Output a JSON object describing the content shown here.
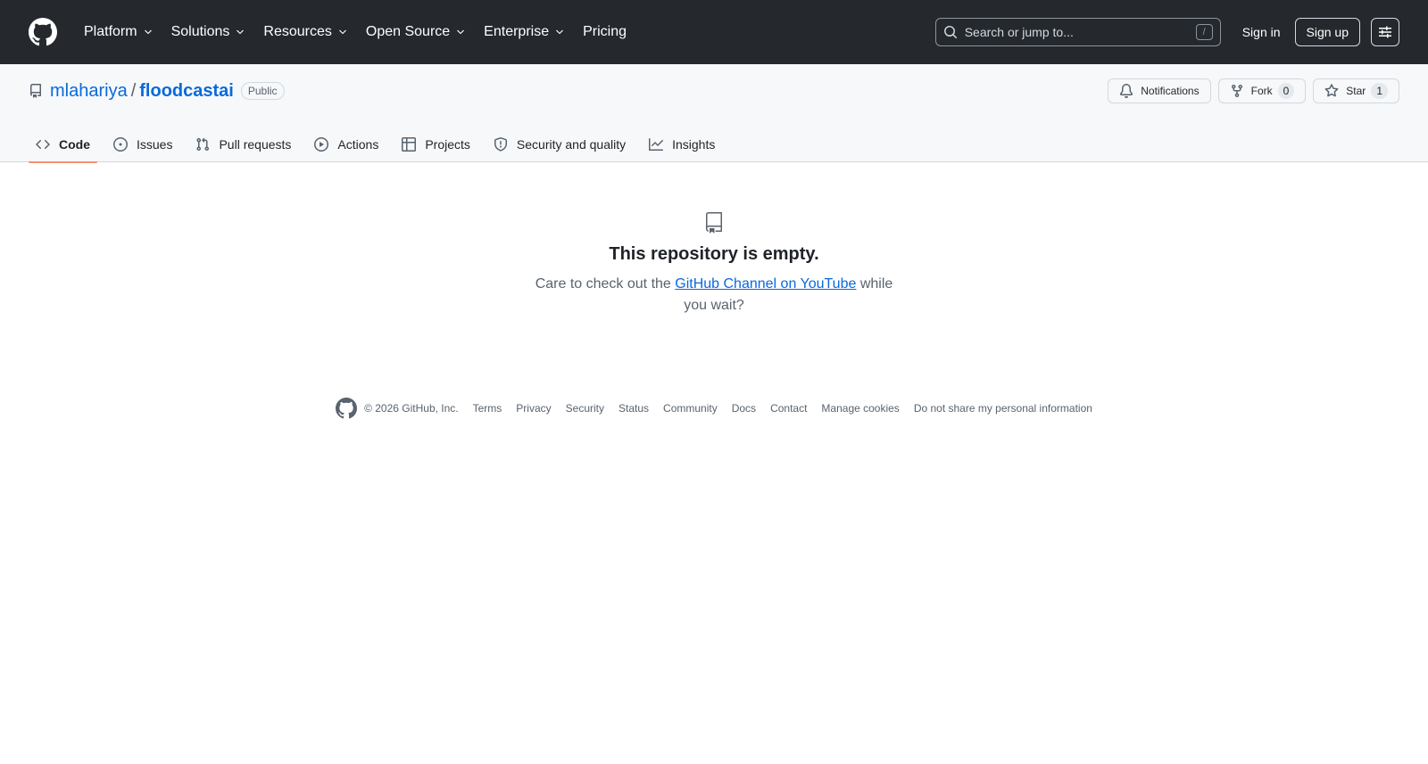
{
  "header": {
    "nav": [
      {
        "label": "Platform",
        "has_menu": true
      },
      {
        "label": "Solutions",
        "has_menu": true
      },
      {
        "label": "Resources",
        "has_menu": true
      },
      {
        "label": "Open Source",
        "has_menu": true
      },
      {
        "label": "Enterprise",
        "has_menu": true
      },
      {
        "label": "Pricing",
        "has_menu": false
      }
    ],
    "search_placeholder": "Search or jump to...",
    "search_shortcut": "/",
    "sign_in": "Sign in",
    "sign_up": "Sign up"
  },
  "repo": {
    "owner": "mlahariya",
    "separator": "/",
    "name": "floodcastai",
    "visibility": "Public",
    "notifications_label": "Notifications",
    "fork_label": "Fork",
    "fork_count": "0",
    "star_label": "Star",
    "star_count": "1"
  },
  "tabs": [
    {
      "label": "Code",
      "icon": "code-icon",
      "active": true
    },
    {
      "label": "Issues",
      "icon": "issue-opened-icon",
      "active": false
    },
    {
      "label": "Pull requests",
      "icon": "git-pull-request-icon",
      "active": false
    },
    {
      "label": "Actions",
      "icon": "play-icon",
      "active": false
    },
    {
      "label": "Projects",
      "icon": "table-icon",
      "active": false
    },
    {
      "label": "Security and quality",
      "icon": "shield-icon",
      "active": false
    },
    {
      "label": "Insights",
      "icon": "graph-icon",
      "active": false
    }
  ],
  "blankslate": {
    "title": "This repository is empty.",
    "text_before": "Care to check out the ",
    "link": "GitHub Channel on YouTube",
    "text_after": " while you wait?"
  },
  "footer": {
    "copyright": "© 2026 GitHub, Inc.",
    "links": [
      "Terms",
      "Privacy",
      "Security",
      "Status",
      "Community",
      "Docs",
      "Contact",
      "Manage cookies",
      "Do not share my personal information"
    ]
  },
  "colors": {
    "header_bg": "#25292e",
    "link": "#0969da",
    "active_tab_underline": "#fd8c73"
  }
}
